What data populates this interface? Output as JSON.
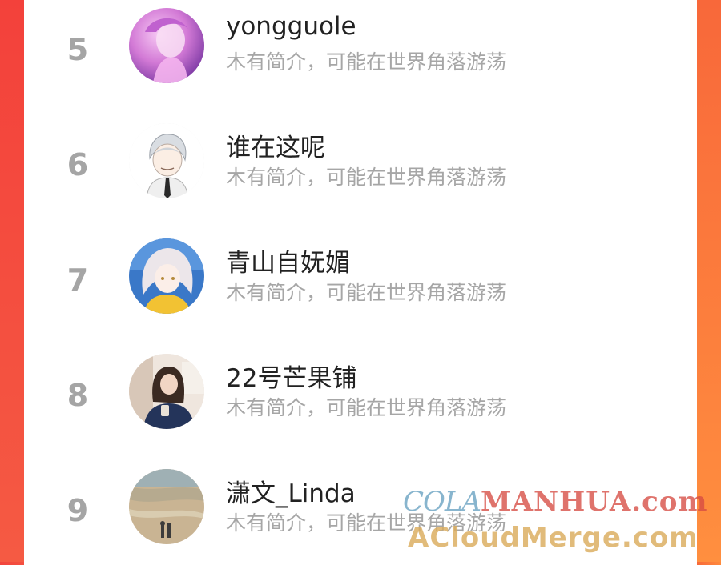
{
  "ranking": {
    "items": [
      {
        "rank": "5",
        "name": "yongguole",
        "description": "木有简介，可能在世界角落游荡"
      },
      {
        "rank": "6",
        "name": "谁在这呢",
        "description": "木有简介，可能在世界角落游荡"
      },
      {
        "rank": "7",
        "name": "青山自妩媚",
        "description": "木有简介，可能在世界角落游荡"
      },
      {
        "rank": "8",
        "name": "22号芒果铺",
        "description": "木有简介，可能在世界角落游荡"
      },
      {
        "rank": "9",
        "name": "潇文_Linda",
        "description": "木有简介，可能在世界角落游荡"
      }
    ]
  },
  "watermark": {
    "line1_left": "COLA",
    "line1_right": "MANHUA.com",
    "line2": "ACloudMerge.com"
  },
  "colors": {
    "accent_left": "#f3413b",
    "accent_right": "#ff8a3c",
    "rank_gray": "#a5a5a5",
    "desc_gray": "#a6a6a6"
  },
  "avatar_icons": [
    "pink-anime-girl-avatar",
    "white-hair-boy-avatar",
    "silver-hair-girl-avatar",
    "girl-photo-avatar",
    "beach-photo-avatar"
  ]
}
